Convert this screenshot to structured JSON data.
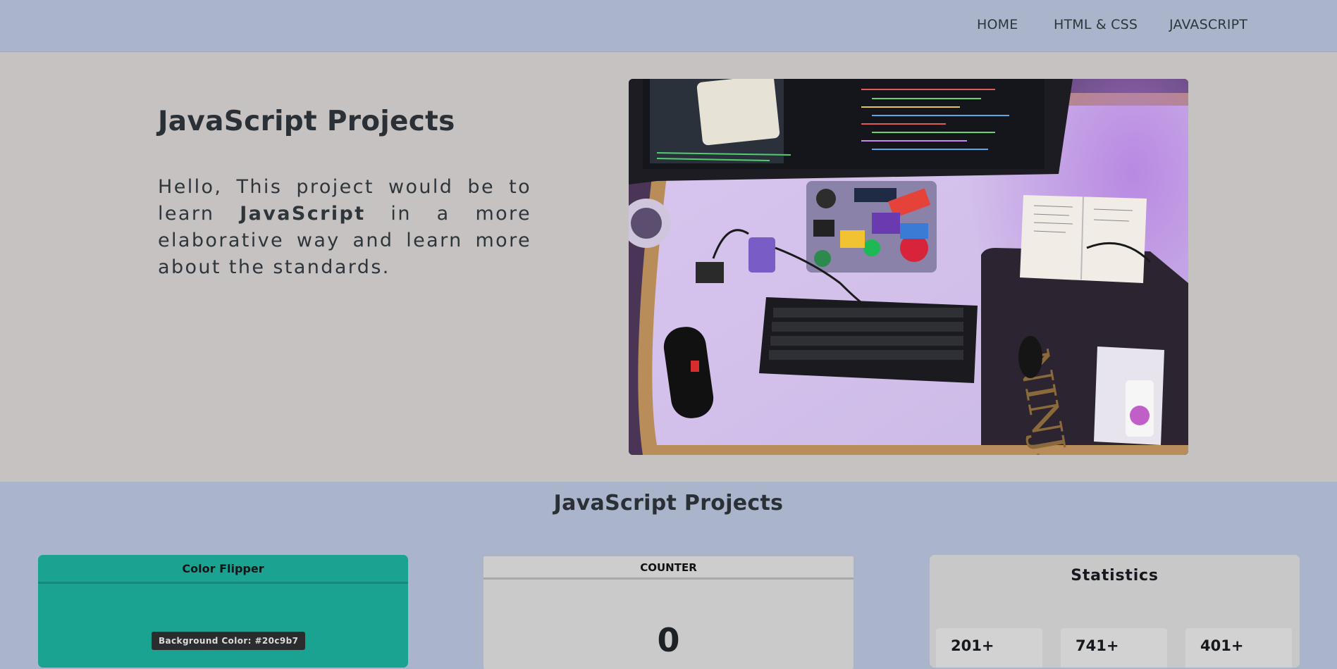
{
  "nav": {
    "items": [
      {
        "label": "HOME"
      },
      {
        "label": "HTML & CSS"
      },
      {
        "label": "JAVASCRIPT"
      }
    ]
  },
  "hero": {
    "title": "JavaScript Projects",
    "text_before": "Hello, This project would be to learn ",
    "text_bold": "JavaScript",
    "text_after": " in a more elaborative way and learn more about the standards."
  },
  "projects": {
    "title": "JavaScript Projects",
    "color_flipper": {
      "title": "Color Flipper",
      "badge": "Background Color: #20c9b7",
      "color": "#20c9b7"
    },
    "counter": {
      "title": "COUNTER",
      "value": "0"
    },
    "statistics": {
      "title": "Statistics",
      "items": [
        {
          "value": "201+"
        },
        {
          "value": "741+"
        },
        {
          "value": "401+"
        }
      ]
    }
  },
  "colors": {
    "nav_bg": "#aab5cb",
    "hero_bg": "#c6c2c2",
    "color_flipper_card": "#1aa391"
  }
}
